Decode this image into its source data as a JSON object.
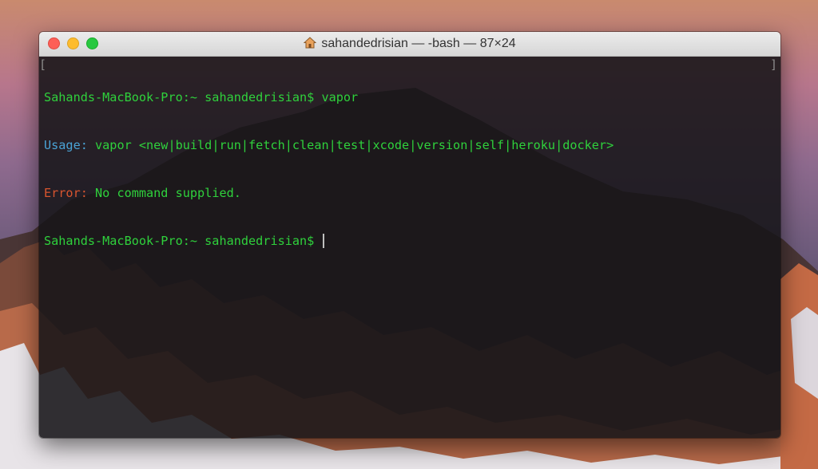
{
  "window": {
    "title": "sahandedrisian — -bash — 87×24"
  },
  "terminal": {
    "lines": [
      {
        "prompt": "Sahands-MacBook-Pro:~ sahandedrisian$",
        "text": " vapor"
      },
      {
        "label": "Usage:",
        "text": " vapor <new|build|run|fetch|clean|test|xcode|version|self|heroku|docker>"
      },
      {
        "label": "Error:",
        "text": " No command supplied."
      },
      {
        "prompt": "Sahands-MacBook-Pro:~ sahandedrisian$",
        "text": " "
      }
    ]
  },
  "icons": {
    "home": "home-icon"
  },
  "colors": {
    "prompt": "#2fd13c",
    "usage": "#4aa3d6",
    "error": "#d9552e",
    "background": "#161418"
  }
}
